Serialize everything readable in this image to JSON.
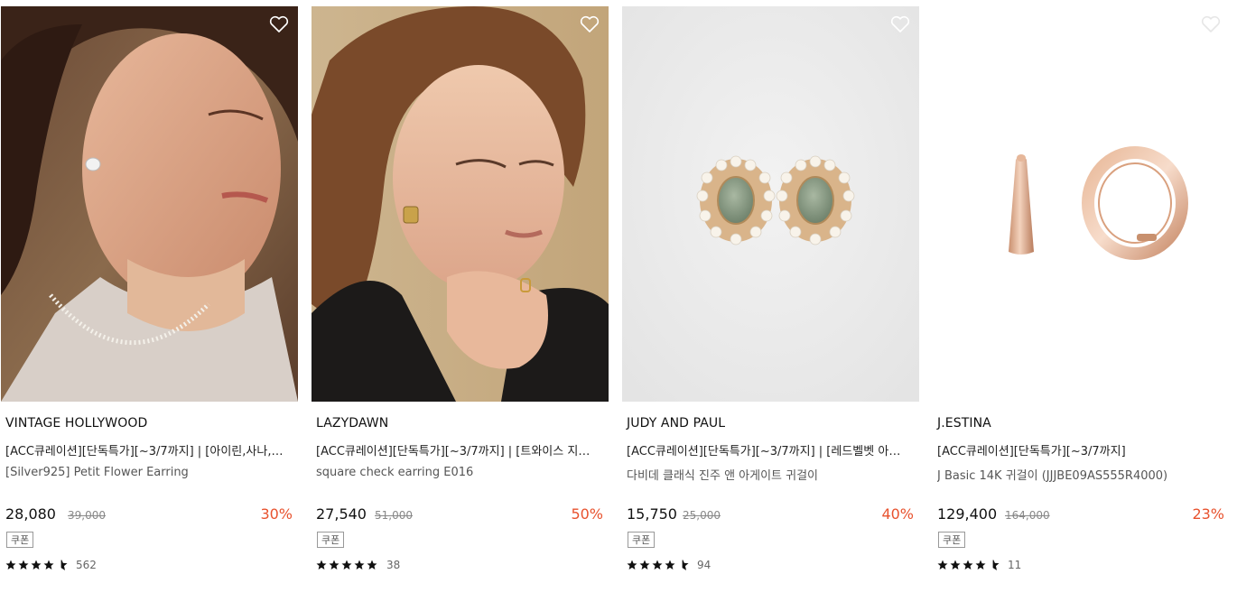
{
  "products": [
    {
      "brand": "VINTAGE HOLLYWOOD",
      "promo": "[ACC큐레이션][단독특가][~3/7까지] | [아이린,사나,장원영,솔라 착용]",
      "name": "[Silver925] Petit Flower Earring",
      "price": "28,080",
      "original_price": "39,000",
      "discount": "30%",
      "coupon": "쿠폰",
      "rating": 4.5,
      "reviews": "562",
      "image": "model-with-flower-earring"
    },
    {
      "brand": "LAZYDAWN",
      "promo": "[ACC큐레이션][단독특가][~3/7까지] | [트와이스 지효, 아이브 착용]",
      "name": "square check earring E016",
      "price": "27,540",
      "original_price": "51,000",
      "discount": "50%",
      "coupon": "쿠폰",
      "rating": 5,
      "reviews": "38",
      "image": "model-with-square-earring"
    },
    {
      "brand": "JUDY AND PAUL",
      "promo": "[ACC큐레이션][단독특가][~3/7까지] | [레드벨벳 아이린 착용]",
      "name": "다비데 클래식 진주 앤 아게이트 귀걸이",
      "price": "15,750",
      "original_price": "25,000",
      "discount": "40%",
      "coupon": "쿠폰",
      "rating": 4.5,
      "reviews": "94",
      "image": "pearl-agate-earrings"
    },
    {
      "brand": "J.ESTINA",
      "promo": "[ACC큐레이션][단독특가][~3/7까지]",
      "name": "J Basic 14K 귀걸이 (JJJBE09AS555R4000)",
      "price": "129,400",
      "original_price": "164,000",
      "discount": "23%",
      "coupon": "쿠폰",
      "rating": 4.5,
      "reviews": "11",
      "image": "gold-hoop-earrings"
    }
  ],
  "icons": {
    "wishlist": "heart-outline-icon",
    "rating": "star-icon"
  },
  "colors": {
    "discount": "#e8522e",
    "star": "#111111",
    "wishlist_outline": "#ffffff"
  }
}
